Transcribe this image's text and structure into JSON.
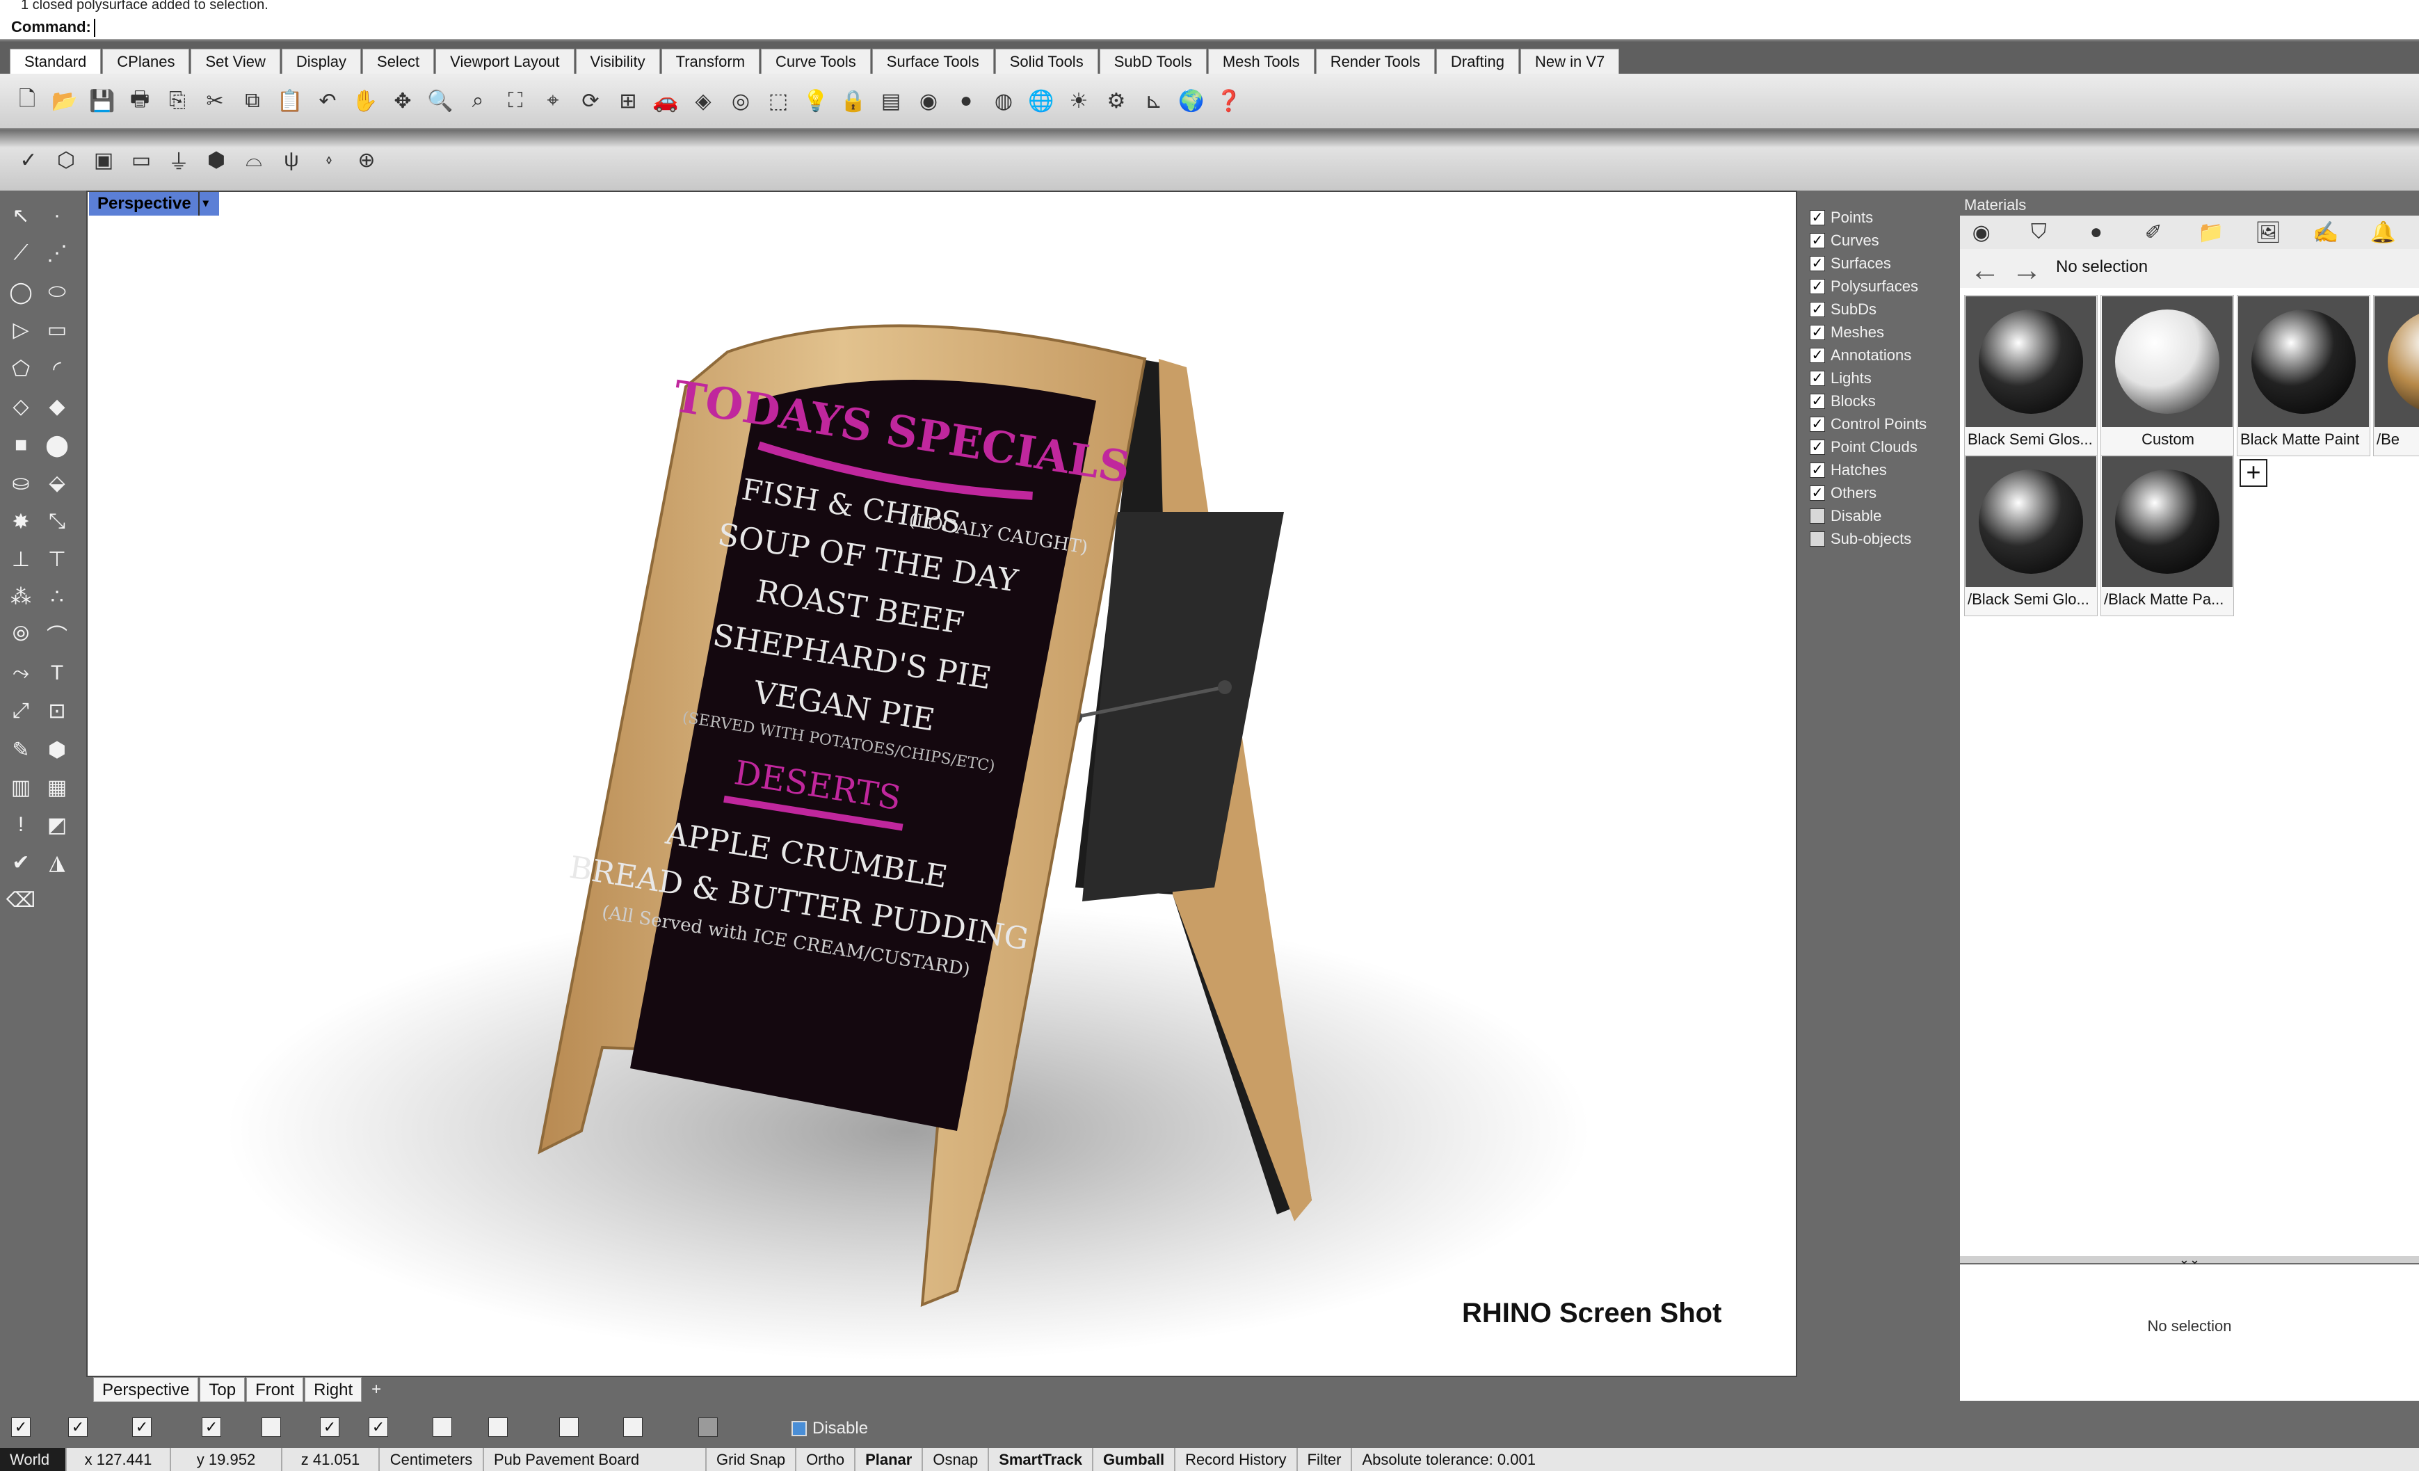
{
  "command": {
    "history_line": "1 closed polysurface added to selection.",
    "prompt_label": "Command:",
    "input_value": ""
  },
  "toolbar_tabs": [
    "Standard",
    "CPlanes",
    "Set View",
    "Display",
    "Select",
    "Viewport Layout",
    "Visibility",
    "Transform",
    "Curve Tools",
    "Surface Tools",
    "Solid Tools",
    "SubD Tools",
    "Mesh Tools",
    "Render Tools",
    "Drafting",
    "New in V7"
  ],
  "active_toolbar_tab": "Standard",
  "viewport": {
    "name": "Perspective",
    "watermark": "RHINO Screen Shot",
    "sign": {
      "title": "TODAYS SPECIALS",
      "items": [
        "FISH & CHIPS",
        "(LOCALY CAUGHT)",
        "SOUP OF THE DAY",
        "ROAST BEEF",
        "SHEPHARD'S PIE",
        "VEGAN PIE",
        "(SERVED WITH POTATOES/CHIPS/ETC)"
      ],
      "desserts_title": "DESERTS",
      "desserts": [
        "APPLE CRUMBLE",
        "BREAD & BUTTER PUDDING",
        "(All Served with ICE CREAM/CUSTARD)"
      ]
    }
  },
  "viewport_tabs": [
    "Perspective",
    "Top",
    "Front",
    "Right",
    "+"
  ],
  "visibility": {
    "items": [
      {
        "label": "Points",
        "checked": true
      },
      {
        "label": "Curves",
        "checked": true
      },
      {
        "label": "Surfaces",
        "checked": true
      },
      {
        "label": "Polysurfaces",
        "checked": true
      },
      {
        "label": "SubDs",
        "checked": true
      },
      {
        "label": "Meshes",
        "checked": true
      },
      {
        "label": "Annotations",
        "checked": true
      },
      {
        "label": "Lights",
        "checked": true
      },
      {
        "label": "Blocks",
        "checked": true
      },
      {
        "label": "Control Points",
        "checked": true
      },
      {
        "label": "Point Clouds",
        "checked": true
      },
      {
        "label": "Hatches",
        "checked": true
      },
      {
        "label": "Others",
        "checked": true
      },
      {
        "label": "Disable",
        "checked": false
      },
      {
        "label": "Sub-objects",
        "checked": false
      }
    ]
  },
  "materials": {
    "panel_title": "Materials",
    "nav_status": "No selection",
    "swatches": [
      {
        "name": "Black Semi Glos...",
        "tone": "#2a2a2a"
      },
      {
        "name": "Custom",
        "tone": "#e4e4e4"
      },
      {
        "name": "Black Matte Paint",
        "tone": "#222222"
      },
      {
        "name": "/Be",
        "tone": "#b88a4a"
      },
      {
        "name": "/Black Semi Glo...",
        "tone": "#2a2a2a"
      },
      {
        "name": "/Black Matte Pa...",
        "tone": "#222222"
      }
    ],
    "add_button": "+",
    "props_status": "No selection"
  },
  "osnap": {
    "disable_label": "Disable"
  },
  "status_bar": {
    "cplane": "World",
    "x": "x 127.441",
    "y": "y 19.952",
    "z": "z 41.051",
    "units": "Centimeters",
    "layer": "Pub Pavement Board",
    "grid_snap": "Grid Snap",
    "ortho": "Ortho",
    "planar": "Planar",
    "osnap": "Osnap",
    "smarttrack": "SmartTrack",
    "gumball": "Gumball",
    "record_history": "Record History",
    "filter": "Filter",
    "tolerance": "Absolute tolerance: 0.001"
  },
  "colors": {
    "viewport_label_bg": "#5b7fd6",
    "sign_frame": "#d3b07c",
    "chalk_magenta": "#c0279d",
    "chalkboard": "#14080f"
  }
}
